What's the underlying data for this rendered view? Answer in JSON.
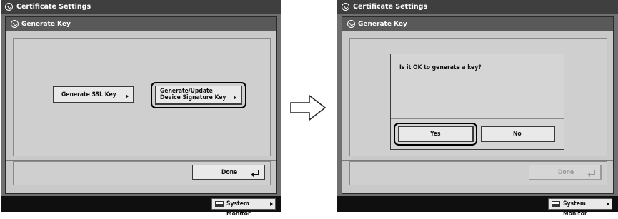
{
  "left_screen": {
    "window_title": "Certificate Settings",
    "panel_title": "Generate Key",
    "buttons": {
      "generate_ssl": "Generate SSL Key",
      "generate_device_sig_line1": "Generate/Update",
      "generate_device_sig_line2": "Device Signature Key",
      "done": "Done"
    },
    "system_monitor": "System Monitor"
  },
  "right_screen": {
    "window_title": "Certificate Settings",
    "panel_title": "Generate Key",
    "dialog": {
      "message": "Is it OK to generate a key?",
      "yes": "Yes",
      "no": "No"
    },
    "done": "Done",
    "system_monitor": "System Monitor"
  }
}
